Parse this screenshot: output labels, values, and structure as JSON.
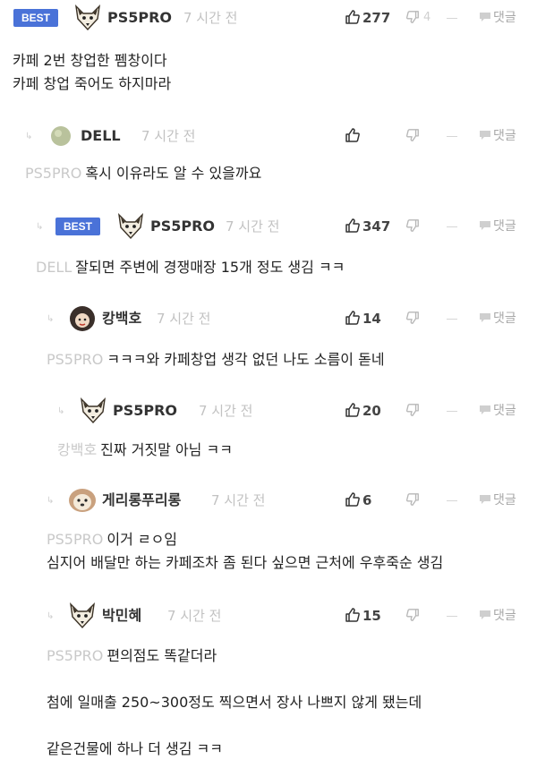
{
  "actions": {
    "reply_label": "댓글",
    "dash": "-"
  },
  "comments": [
    {
      "best": "BEST",
      "author": "PS5PRO",
      "time": "7 시간 전",
      "likes": "277",
      "dislikes": "4",
      "lines": [
        "카페 2번 창업한 펨창이다",
        "카페 창업 죽어도 하지마라"
      ]
    },
    {
      "author": "DELL",
      "time": "7 시간 전",
      "mention": "PS5PRO",
      "lines": [
        "혹시 이유라도 알 수 있을까요"
      ]
    },
    {
      "best": "BEST",
      "author": "PS5PRO",
      "time": "7 시간 전",
      "likes": "347",
      "mention": "DELL",
      "lines": [
        "잘되면 주변에 경쟁매장 15개 정도 생김 ㅋㅋ"
      ]
    },
    {
      "author": "캉백호",
      "time": "7 시간 전",
      "likes": "14",
      "mention": "PS5PRO",
      "lines": [
        "ㅋㅋㅋ와 카페창업 생각 없던 나도 소름이 돋네"
      ]
    },
    {
      "author": "PS5PRO",
      "time": "7 시간 전",
      "likes": "20",
      "mention": "캉백호",
      "lines": [
        "진짜 거짓말 아님 ㅋㅋ"
      ]
    },
    {
      "author": "게리롱푸리롱",
      "time": "7 시간 전",
      "likes": "6",
      "mention": "PS5PRO",
      "lines": [
        "이거 ㄹㅇ임",
        "심지어 배달만 하는 카페조차 좀 된다 싶으면 근처에 우후죽순 생김"
      ]
    },
    {
      "author": "박민혜",
      "time": "7 시간 전",
      "likes": "15",
      "mention": "PS5PRO",
      "lines": [
        "편의점도 똑같더라",
        "",
        "첨에 일매출 250~300정도 찍으면서 장사 나쁘지 않게 됐는데",
        "",
        "같은건물에 하나 더 생김 ㅋㅋ"
      ]
    }
  ]
}
